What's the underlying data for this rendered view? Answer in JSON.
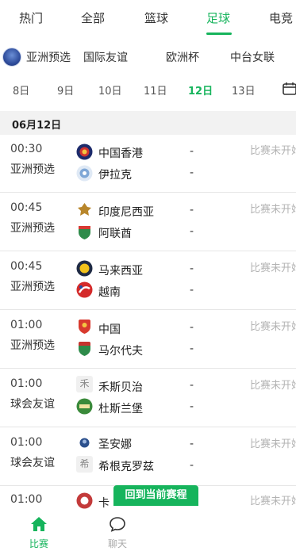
{
  "top_tabs": [
    "热门",
    "全部",
    "篮球",
    "足球",
    "电竞"
  ],
  "active_top_tab": "足球",
  "leagues": [
    "亚洲预选",
    "国际友谊",
    "欧洲杯",
    "中台女联"
  ],
  "dates": [
    "8日",
    "9日",
    "10日",
    "11日",
    "12日",
    "13日"
  ],
  "active_date": "12日",
  "section_date": "06月12日",
  "matches": [
    {
      "time": "00:30",
      "league": "亚洲预选",
      "home": "中国香港",
      "away": "伊拉克",
      "home_score": "-",
      "away_score": "-",
      "status": "比赛未开始"
    },
    {
      "time": "00:45",
      "league": "亚洲预选",
      "home": "印度尼西亚",
      "away": "阿联酋",
      "home_score": "-",
      "away_score": "-",
      "status": "比赛未开始"
    },
    {
      "time": "00:45",
      "league": "亚洲预选",
      "home": "马来西亚",
      "away": "越南",
      "home_score": "-",
      "away_score": "-",
      "status": "比赛未开始"
    },
    {
      "time": "01:00",
      "league": "亚洲预选",
      "home": "中国",
      "away": "马尔代夫",
      "home_score": "-",
      "away_score": "-",
      "status": "比赛未开始"
    },
    {
      "time": "01:00",
      "league": "球会友谊",
      "home": "禾斯贝治",
      "away": "杜斯兰堡",
      "home_score": "-",
      "away_score": "-",
      "status": "比赛未开始"
    },
    {
      "time": "01:00",
      "league": "球会友谊",
      "home": "圣安娜",
      "away": "希根克罗兹",
      "home_score": "-",
      "away_score": "-",
      "status": "比赛未开始"
    },
    {
      "time": "01:00",
      "league": "",
      "home": "卡",
      "away": "",
      "home_score": "",
      "away_score": "",
      "status": "比赛未开始"
    }
  ],
  "float_button": "回到当前赛程",
  "bottom_nav": [
    {
      "label": "比赛",
      "icon": "home-icon",
      "active": true
    },
    {
      "label": "聊天",
      "icon": "chat-icon",
      "active": false
    }
  ],
  "accent_color": "#16b45c"
}
